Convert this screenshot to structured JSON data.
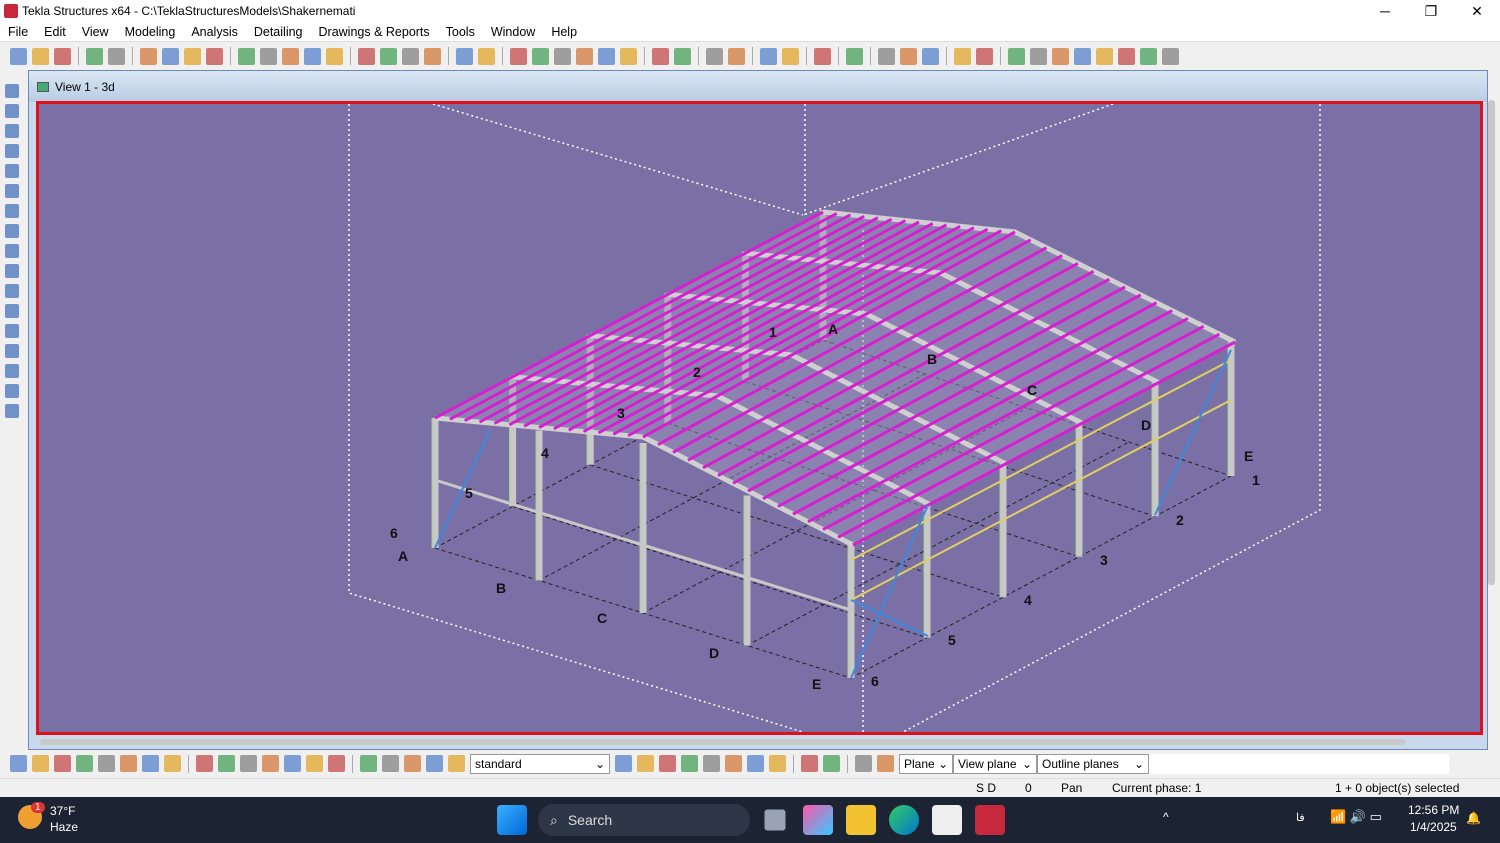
{
  "window": {
    "title": "Tekla Structures x64 - C:\\TeklaStructuresModels\\Shakernemati",
    "minimize": "─",
    "maximize": "❐",
    "close": "✕"
  },
  "menu": [
    "File",
    "Edit",
    "View",
    "Modeling",
    "Analysis",
    "Detailing",
    "Drawings & Reports",
    "Tools",
    "Window",
    "Help"
  ],
  "view": {
    "title": "View 1 - 3d",
    "background": "#7a70a6",
    "frame_color": "#e0101a",
    "purlin_color": "#d61fd0"
  },
  "grid_labels": {
    "front_letters": [
      "A",
      "B",
      "C",
      "D",
      "E"
    ],
    "front_numbers": [
      "6",
      "5",
      "4",
      "3",
      "2",
      "1"
    ],
    "right_numbers": [
      "6",
      "5",
      "4",
      "3",
      "2",
      "1"
    ],
    "back_letters": [
      "A",
      "B",
      "C",
      "D",
      "E"
    ]
  },
  "bottom_toolbar": {
    "filter": "standard",
    "plane": "Plane",
    "view_plane": "View plane",
    "outline": "Outline planes"
  },
  "status": {
    "sd": "S D",
    "value": "0",
    "mode": "Pan",
    "phase": "Current phase: 1",
    "selected": "1 + 0 object(s) selected"
  },
  "taskbar": {
    "weather_temp": "37°F",
    "weather_desc": "Haze",
    "badge": "1",
    "search": "Search",
    "time": "12:56 PM",
    "date": "1/4/2025",
    "lang": "فا"
  }
}
